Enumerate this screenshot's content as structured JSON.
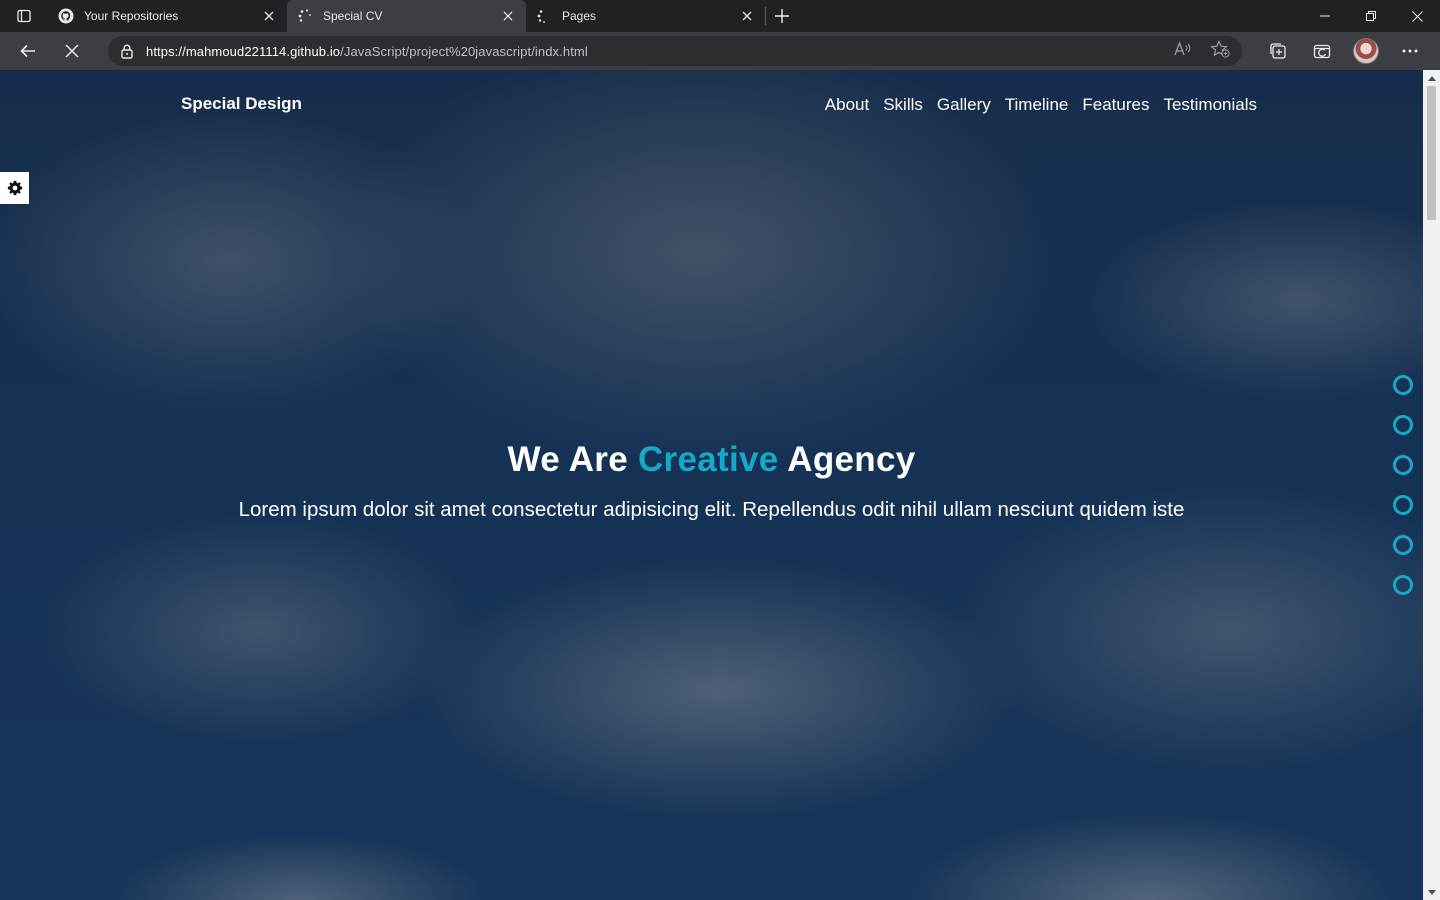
{
  "browser": {
    "tabs": [
      {
        "title": "Your Repositories",
        "icon": "github-icon",
        "active": false
      },
      {
        "title": "Special CV",
        "icon": "loading-spinner-icon",
        "active": true
      },
      {
        "title": "Pages",
        "icon": "loading-spinner-icon",
        "active": false
      }
    ],
    "url_host": "https://mahmoud221114.github.io",
    "url_path": "/JavaScript/project%20javascript/indx.html"
  },
  "site": {
    "logo": "Special Design",
    "nav": [
      "About",
      "Skills",
      "Gallery",
      "Timeline",
      "Features",
      "Testimonials"
    ],
    "hero": {
      "title_pre": "We Are ",
      "title_accent": "Creative",
      "title_post": " Agency",
      "subtitle": "Lorem ipsum dolor sit amet consectetur adipisicing elit. Repellendus odit nihil ullam nesciunt quidem iste"
    },
    "bullet_count": 6,
    "accent_color": "#15a8c8"
  }
}
